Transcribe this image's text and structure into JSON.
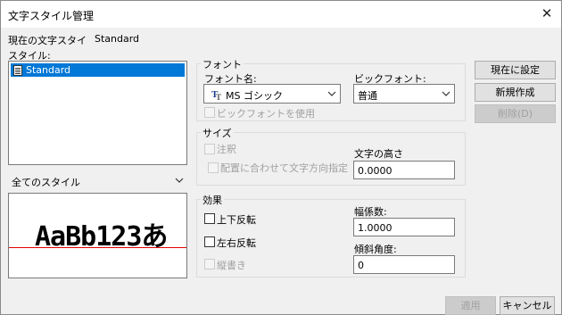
{
  "dialog": {
    "title": "文字スタイル管理",
    "current_style_label": "現在の文字スタイ",
    "current_style_value": "Standard"
  },
  "styles": {
    "label": "スタイル:",
    "items": [
      "Standard"
    ],
    "filter": "全てのスタイル",
    "preview_text": "AaBb123あ"
  },
  "font": {
    "group": "フォント",
    "name_label": "フォント名:",
    "name_value": "MS ゴシック",
    "name_icon": "truetype-icon",
    "big_label": "ビックフォント:",
    "big_value": "普通",
    "use_big": "ビックフォントを使用"
  },
  "size": {
    "group": "サイズ",
    "annotative": "注釈",
    "match_orientation": "配置に合わせて文字方向指定",
    "height_label": "文字の高さ",
    "height_value": "0.0000"
  },
  "effects": {
    "group": "効果",
    "upside_down": "上下反転",
    "backwards": "左右反転",
    "vertical": "縦書き",
    "width_label": "幅係数:",
    "width_value": "1.0000",
    "oblique_label": "傾斜角度:",
    "oblique_value": "0"
  },
  "buttons": {
    "set_current": "現在に設定",
    "new": "新規作成",
    "delete": "削除(D)",
    "apply": "適用",
    "cancel": "キャンセル"
  },
  "colors": {
    "selection": "#0078d7",
    "baseline": "#e00000"
  }
}
